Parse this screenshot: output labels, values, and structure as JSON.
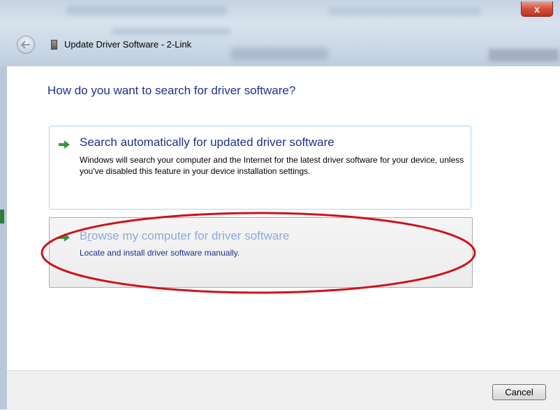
{
  "window": {
    "title": "Update Driver Software - 2-Link",
    "close_label": "x"
  },
  "wizard": {
    "heading": "How do you want to search for driver software?",
    "options": [
      {
        "title": "Search automatically for updated driver software",
        "description": "Windows will search your computer and the Internet for the latest driver software for your device, unless you've disabled this feature in your device installation settings."
      },
      {
        "title_access_key": "r",
        "title_before_key": "B",
        "title_after_key": "owse my computer for driver software",
        "description": "Locate and install driver software manually."
      }
    ]
  },
  "footer": {
    "cancel_label": "Cancel"
  },
  "colors": {
    "heading": "#1e3287",
    "arrow": "#2e9a3a",
    "annotation": "#d0101a"
  },
  "icons": {
    "back": "back-arrow-icon",
    "option": "green-arrow-icon",
    "wizard": "device-icon"
  }
}
